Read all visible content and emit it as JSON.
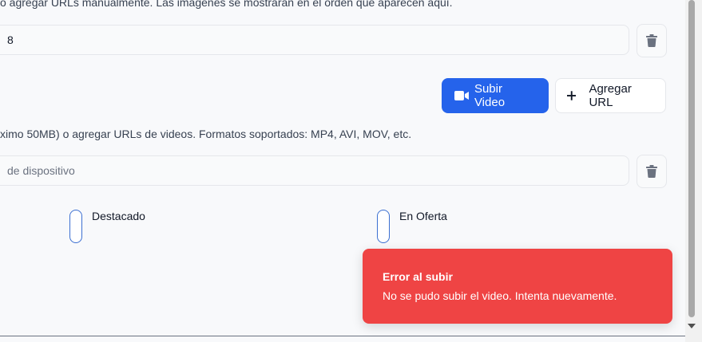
{
  "images": {
    "help_text": "o agregar URLs manualmente. Las imágenes se mostrarán en el orden que aparecen aquí.",
    "url_value": "8"
  },
  "videos": {
    "upload_button_label": "Subir Video",
    "add_url_button_label": "Agregar URL",
    "help_text": "ximo 50MB) o agregar URLs de videos. Formatos soportados: MP4, AVI, MOV, etc.",
    "url_placeholder": "de dispositivo"
  },
  "toggles": {
    "featured_label": "Destacado",
    "on_sale_label": "En Oferta"
  },
  "toast": {
    "title": "Error al subir",
    "description": "No se pudo subir el video. Intenta nuevamente."
  },
  "colors": {
    "primary": "#2563eb",
    "error": "#ef4444",
    "toggle_border": "#3b6fd1"
  },
  "icons": {
    "trash": "trash-icon",
    "video": "video-camera-icon",
    "plus": "plus-icon"
  }
}
